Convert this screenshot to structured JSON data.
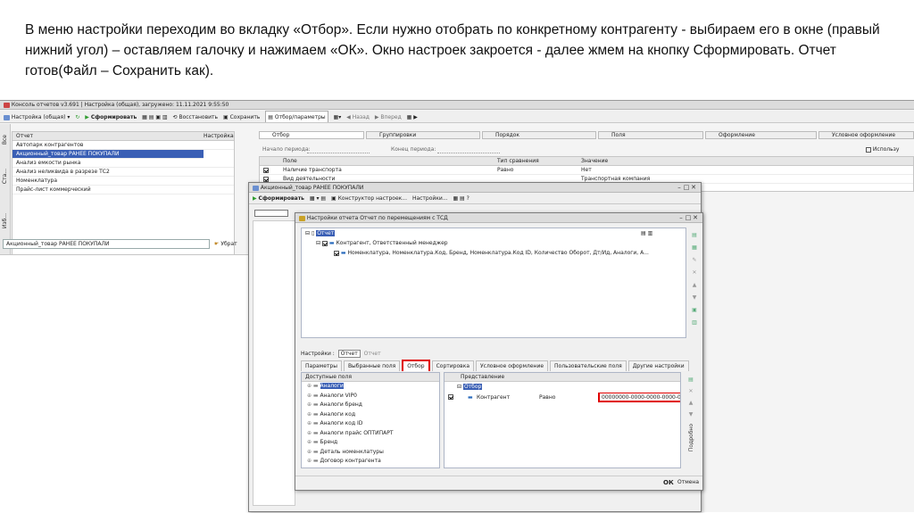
{
  "caption": "В меню настройки переходим во вкладку «Отбор». Если нужно отобрать по конкретному контрагенту - выбираем его в окне (правый нижний угол) – оставляем галочку и нажимаем «ОК». Окно настроек закроется - далее жмем на кнопку Сформировать. Отчет готов(Файл – Сохранить как).",
  "main_window": {
    "title": "Консоль отчетов v3.691 | Настройка (общая), загружено: 11.11.2021 9:55:50",
    "toolbar": {
      "settings_label": "Настройка (общая)",
      "generate": "Сформировать",
      "restore": "Восстановить",
      "save": "Сохранить",
      "filter_params": "Отбор/параметры",
      "back": "Назад",
      "forward": "Вперед"
    },
    "side_tabs": [
      "Все",
      "Ста...",
      "Изб..."
    ],
    "report_list": {
      "col_report": "Отчет",
      "col_setting": "Настройка",
      "items": [
        "Автопарк контрагентов",
        "Акционный_товар РАНЕЕ ПОКУПАЛИ",
        "Анализ емкости рынка",
        "Анализ неликвида в разрезе ТС2",
        "Номенклатура",
        "Прайс-лист коммерческий"
      ]
    },
    "selected_report_field": "Акционный_товар РАНЕЕ ПОКУПАЛИ",
    "choose_label": "Убрат",
    "right_tabs": [
      "Отбор",
      "Группировки",
      "Порядок",
      "Поля",
      "Оформление",
      "Условное оформление"
    ],
    "period": {
      "start": "Начало периода:",
      "end": "Конец периода:"
    },
    "use_label": "Использу",
    "filter_grid": {
      "headers": [
        "Поле",
        "Тип сравнения",
        "Значение"
      ],
      "rows": [
        {
          "field": "Наличие транспорта",
          "compare": "Равно",
          "value": "Нет"
        },
        {
          "field": "Вид деятельности",
          "compare": "",
          "value": "Транспортная компания"
        }
      ]
    }
  },
  "report_window": {
    "title": "Акционный_товар РАНЕЕ ПОКУПАЛИ",
    "toolbar": {
      "generate": "Сформировать",
      "constructor": "Конструктор настроек...",
      "settings": "Настройки..."
    }
  },
  "settings_window": {
    "title": "Настройки отчета  Отчет по перемещениям с ТСД",
    "tree": {
      "root": "Отчет",
      "level1": "Контрагент, Ответственный менеджер",
      "level2": "Номенклатура, Номенклатура.Код, Бренд, Номенклатура.Код ID, Количество Оборот, Дт/Ид, Аналоги, А..."
    },
    "settings_for_label": "Настройки :",
    "settings_for_value": "Отчет",
    "settings_for_hint": "Отчет",
    "tabs": [
      "Параметры",
      "Выбранные поля",
      "Отбор",
      "Сортировка",
      "Условное оформление",
      "Пользовательские поля",
      "Другие настройки"
    ],
    "active_tab": "Отбор",
    "available_fields_header": "Доступные поля",
    "available_fields": [
      "Аналоги",
      "Аналоги VIP0",
      "Аналоги бренд",
      "Аналоги код",
      "Аналоги код ID",
      "Аналоги прайс ОПТИПАРТ",
      "Бренд",
      "Деталь номенклатуры",
      "Договор контрагента"
    ],
    "representation_header": "Представление",
    "filter_root": "Отбор",
    "filter_row": {
      "field": "Контрагент",
      "compare": "Равно",
      "value": "00000000-0000-0000-0000-00"
    },
    "detail_label": "Подробно",
    "ok": "ОК",
    "cancel": "Отмена"
  },
  "colors": {
    "accent_red": "#e00000",
    "selection": "#3a5fb5",
    "green_go": "#2e9b2e"
  }
}
